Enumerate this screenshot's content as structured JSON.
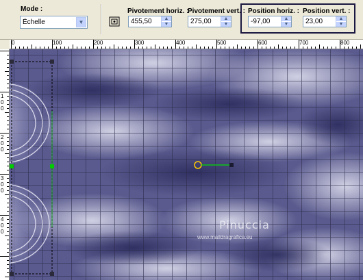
{
  "toolbar": {
    "mode_label": "Mode :",
    "mode_value": "Échelle",
    "pivot_h_label": "Pivotement horiz. :",
    "pivot_h_value": "455,50",
    "pivot_v_label": "Pivotement vert. :",
    "pivot_v_value": "275,00",
    "pos_h_label": "Position horiz. :",
    "pos_h_value": "-97,00",
    "pos_v_label": "Position vert. :",
    "pos_v_value": "23,00",
    "highlight_color": "#1b1740",
    "accent_color": "#c3d3fd"
  },
  "ruler": {
    "horizontal_labels": [
      "0",
      "100",
      "200",
      "300",
      "400",
      "500",
      "600",
      "700",
      "800"
    ],
    "vertical_labels": [
      "1",
      "0",
      "0",
      "2",
      "0",
      "0",
      "3",
      "0",
      "0",
      "4",
      "0",
      "0"
    ]
  },
  "canvas": {
    "watermark_name": "Pinuccia",
    "watermark_url": "www.maildragrafica.eu",
    "background_color": "#5a5a8e",
    "handle_color": "#2a2a3a",
    "guide_color": "#00cc00"
  }
}
